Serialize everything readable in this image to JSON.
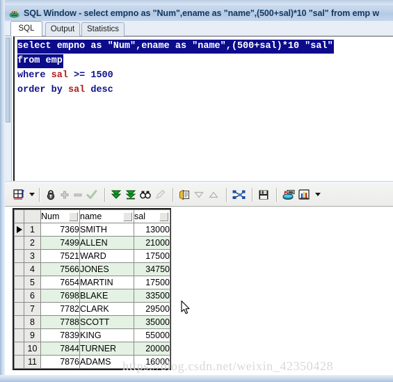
{
  "window": {
    "title": "SQL Window - select empno as \"Num\",ename as \"name\",(500+sal)*10 \"sal\" from emp w",
    "icon": "sql-window-icon"
  },
  "tabs": [
    {
      "label": "SQL",
      "active": true
    },
    {
      "label": "Output",
      "active": false
    },
    {
      "label": "Statistics",
      "active": false
    }
  ],
  "editor": {
    "lines": [
      {
        "text": "select empno as \"Num\",ename as \"name\",(500+sal)*10 \"sal\"",
        "selected": true
      },
      {
        "text": "from emp",
        "selected": true
      },
      {
        "text": "where sal >= 1500",
        "selected": false
      },
      {
        "text": "order by sal desc",
        "selected": false
      }
    ],
    "selection_color": "#0b0b8c",
    "keyword_color": "#12128c",
    "identifier_color": "#b01c1c"
  },
  "toolbar": {
    "items": [
      {
        "name": "grid-view-icon",
        "label": "Grid view",
        "enabled": true,
        "dropdown": true
      },
      {
        "name": "lock-icon",
        "label": "Lock record",
        "enabled": true
      },
      {
        "name": "plus-icon",
        "label": "Insert record",
        "enabled": false
      },
      {
        "name": "minus-icon",
        "label": "Delete record",
        "enabled": false
      },
      {
        "name": "check-icon",
        "label": "Post changes",
        "enabled": false
      },
      {
        "name": "fetch-next-icon",
        "label": "Fetch next page",
        "enabled": true
      },
      {
        "name": "fetch-last-icon",
        "label": "Fetch last page",
        "enabled": true
      },
      {
        "name": "find-icon",
        "label": "Find",
        "enabled": true
      },
      {
        "name": "pencil-icon",
        "label": "Edit data",
        "enabled": false
      },
      {
        "name": "copy-icon",
        "label": "Copy to clipboard",
        "enabled": true
      },
      {
        "name": "sort-desc-icon",
        "label": "Sort descending",
        "enabled": false
      },
      {
        "name": "sort-asc-icon",
        "label": "Sort ascending",
        "enabled": false
      },
      {
        "name": "explain-plan-icon",
        "label": "Explain plan",
        "enabled": true
      },
      {
        "name": "save-icon",
        "label": "Save",
        "enabled": true
      },
      {
        "name": "export-data-icon",
        "label": "Export data",
        "enabled": true
      },
      {
        "name": "chart-icon",
        "label": "Chart",
        "enabled": true,
        "dropdown": true
      }
    ]
  },
  "grid": {
    "columns": [
      "Num",
      "name",
      "sal"
    ],
    "current_row": 1,
    "rows": [
      {
        "n": 1,
        "Num": "7369",
        "name": "SMITH",
        "sal": "13000"
      },
      {
        "n": 2,
        "Num": "7499",
        "name": "ALLEN",
        "sal": "21000"
      },
      {
        "n": 3,
        "Num": "7521",
        "name": "WARD",
        "sal": "17500"
      },
      {
        "n": 4,
        "Num": "7566",
        "name": "JONES",
        "sal": "34750"
      },
      {
        "n": 5,
        "Num": "7654",
        "name": "MARTIN",
        "sal": "17500"
      },
      {
        "n": 6,
        "Num": "7698",
        "name": "BLAKE",
        "sal": "33500"
      },
      {
        "n": 7,
        "Num": "7782",
        "name": "CLARK",
        "sal": "29500"
      },
      {
        "n": 8,
        "Num": "7788",
        "name": "SCOTT",
        "sal": "35000"
      },
      {
        "n": 9,
        "Num": "7839",
        "name": "KING",
        "sal": "55000"
      },
      {
        "n": 10,
        "Num": "7844",
        "name": "TURNER",
        "sal": "20000"
      },
      {
        "n": 11,
        "Num": "7876",
        "name": "ADAMS",
        "sal": "16000"
      }
    ],
    "alt_row_color": "#e4f2e4"
  },
  "watermark": {
    "text": "https://blog.csdn.net/weixin_42350428"
  }
}
